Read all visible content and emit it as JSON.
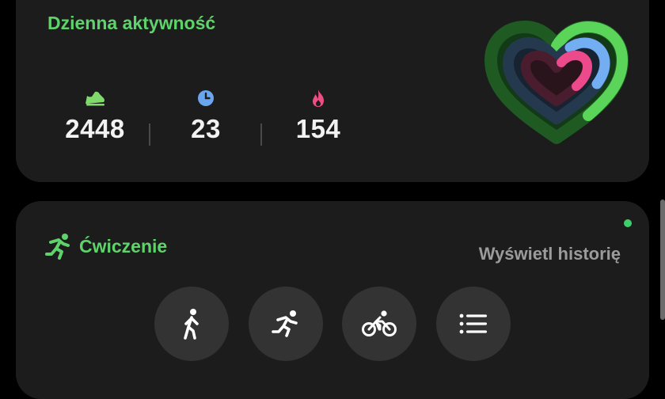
{
  "activity": {
    "title": "Dzienna aktywność",
    "stats": [
      {
        "icon": "shoe-icon",
        "value": "2448",
        "color": "#7fd96b"
      },
      {
        "icon": "clock-icon",
        "value": "23",
        "color": "#6aa6ee"
      },
      {
        "icon": "flame-icon",
        "value": "154",
        "color": "#ee4e86"
      }
    ],
    "rings": {
      "icon": "activity-heart-rings",
      "colors": {
        "steps": "#5bd45a",
        "minutes": "#74aef2",
        "calories": "#ec4a8a"
      }
    }
  },
  "exercise": {
    "title": "Ćwiczenie",
    "icon": "running-person-icon",
    "history_link": "Wyświetl historię",
    "buttons": [
      {
        "icon": "walk-icon"
      },
      {
        "icon": "run-icon"
      },
      {
        "icon": "bike-icon"
      },
      {
        "icon": "list-icon"
      }
    ]
  },
  "colors": {
    "accent_green": "#5fd36b",
    "card": "#1c1c1c",
    "background": "#000000"
  }
}
